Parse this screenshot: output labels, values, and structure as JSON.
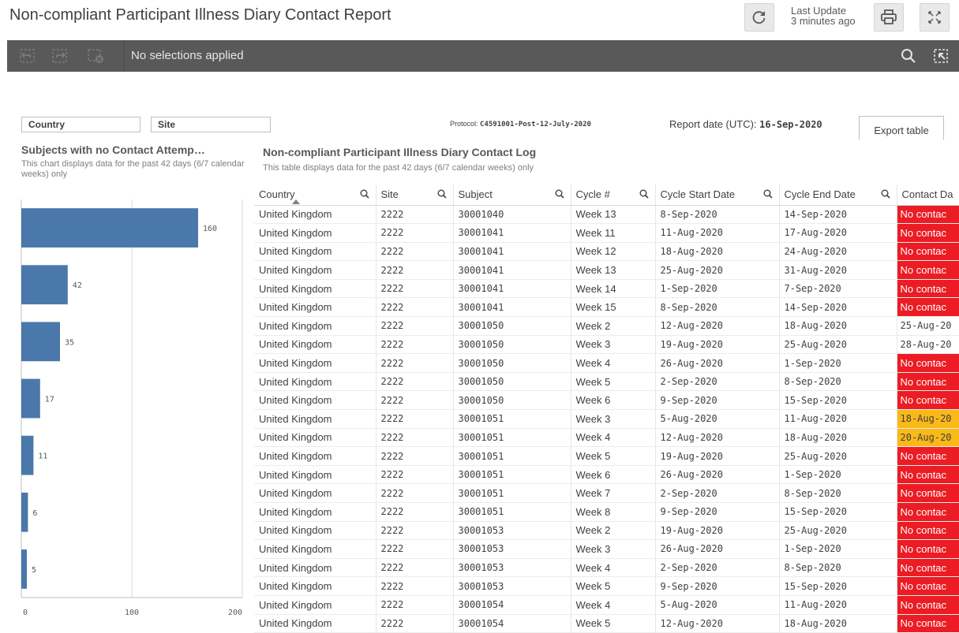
{
  "app": {
    "title": "Non-compliant Participant Illness Diary Contact Report",
    "last_update_line1": "Last Update",
    "last_update_line2": "3 minutes ago"
  },
  "selection_bar": {
    "status": "No selections applied"
  },
  "filters": {
    "country_label": "Country",
    "site_label": "Site"
  },
  "header": {
    "protocol_label": "Protocol:",
    "protocol_value": "C4591001-Post-12-July-2020",
    "report_date_label": "Report date (UTC):",
    "report_date_value": "16-Sep-2020",
    "export_label": "Export table"
  },
  "chart_panel": {
    "title": "Subjects with no Contact Attemp…",
    "subtitle": "This chart displays data for the past 42 days (6/7 calendar weeks) only"
  },
  "chart_data": {
    "type": "bar",
    "orientation": "horizontal",
    "values": [
      160,
      42,
      35,
      17,
      11,
      6,
      5
    ],
    "xlim": [
      0,
      200
    ],
    "xticks": [
      0,
      100,
      200
    ],
    "bar_color": "#4a78ab",
    "grid": true
  },
  "table_panel": {
    "title": "Non-compliant Participant Illness Diary Contact Log",
    "subtitle": "This table displays data for the past 42 days (6/7 calendar weeks) only"
  },
  "table": {
    "columns": [
      "Country",
      "Site",
      "Subject",
      "Cycle #",
      "Cycle Start Date",
      "Cycle End Date",
      "Contact Da"
    ],
    "status_colors": {
      "red": "#ec1c24",
      "amber": "#f8b919"
    },
    "rows": [
      [
        "United Kingdom",
        "2222",
        "30001040",
        "Week 13",
        "8-Sep-2020",
        "14-Sep-2020",
        "No contac",
        "red"
      ],
      [
        "United Kingdom",
        "2222",
        "30001041",
        "Week 11",
        "11-Aug-2020",
        "17-Aug-2020",
        "No contac",
        "red"
      ],
      [
        "United Kingdom",
        "2222",
        "30001041",
        "Week 12",
        "18-Aug-2020",
        "24-Aug-2020",
        "No contac",
        "red"
      ],
      [
        "United Kingdom",
        "2222",
        "30001041",
        "Week 13",
        "25-Aug-2020",
        "31-Aug-2020",
        "No contac",
        "red"
      ],
      [
        "United Kingdom",
        "2222",
        "30001041",
        "Week 14",
        "1-Sep-2020",
        "7-Sep-2020",
        "No contac",
        "red"
      ],
      [
        "United Kingdom",
        "2222",
        "30001041",
        "Week 15",
        "8-Sep-2020",
        "14-Sep-2020",
        "No contac",
        "red"
      ],
      [
        "United Kingdom",
        "2222",
        "30001050",
        "Week 2",
        "12-Aug-2020",
        "18-Aug-2020",
        "25-Aug-20",
        "none"
      ],
      [
        "United Kingdom",
        "2222",
        "30001050",
        "Week 3",
        "19-Aug-2020",
        "25-Aug-2020",
        "28-Aug-20",
        "none"
      ],
      [
        "United Kingdom",
        "2222",
        "30001050",
        "Week 4",
        "26-Aug-2020",
        "1-Sep-2020",
        "No contac",
        "red"
      ],
      [
        "United Kingdom",
        "2222",
        "30001050",
        "Week 5",
        "2-Sep-2020",
        "8-Sep-2020",
        "No contac",
        "red"
      ],
      [
        "United Kingdom",
        "2222",
        "30001050",
        "Week 6",
        "9-Sep-2020",
        "15-Sep-2020",
        "No contac",
        "red"
      ],
      [
        "United Kingdom",
        "2222",
        "30001051",
        "Week 3",
        "5-Aug-2020",
        "11-Aug-2020",
        "18-Aug-20",
        "amber"
      ],
      [
        "United Kingdom",
        "2222",
        "30001051",
        "Week 4",
        "12-Aug-2020",
        "18-Aug-2020",
        "20-Aug-20",
        "amber"
      ],
      [
        "United Kingdom",
        "2222",
        "30001051",
        "Week 5",
        "19-Aug-2020",
        "25-Aug-2020",
        "No contac",
        "red"
      ],
      [
        "United Kingdom",
        "2222",
        "30001051",
        "Week 6",
        "26-Aug-2020",
        "1-Sep-2020",
        "No contac",
        "red"
      ],
      [
        "United Kingdom",
        "2222",
        "30001051",
        "Week 7",
        "2-Sep-2020",
        "8-Sep-2020",
        "No contac",
        "red"
      ],
      [
        "United Kingdom",
        "2222",
        "30001051",
        "Week 8",
        "9-Sep-2020",
        "15-Sep-2020",
        "No contac",
        "red"
      ],
      [
        "United Kingdom",
        "2222",
        "30001053",
        "Week 2",
        "19-Aug-2020",
        "25-Aug-2020",
        "No contac",
        "red"
      ],
      [
        "United Kingdom",
        "2222",
        "30001053",
        "Week 3",
        "26-Aug-2020",
        "1-Sep-2020",
        "No contac",
        "red"
      ],
      [
        "United Kingdom",
        "2222",
        "30001053",
        "Week 4",
        "2-Sep-2020",
        "8-Sep-2020",
        "No contac",
        "red"
      ],
      [
        "United Kingdom",
        "2222",
        "30001053",
        "Week 5",
        "9-Sep-2020",
        "15-Sep-2020",
        "No contac",
        "red"
      ],
      [
        "United Kingdom",
        "2222",
        "30001054",
        "Week 4",
        "5-Aug-2020",
        "11-Aug-2020",
        "No contac",
        "red"
      ],
      [
        "United Kingdom",
        "2222",
        "30001054",
        "Week 5",
        "12-Aug-2020",
        "18-Aug-2020",
        "No contac",
        "red"
      ]
    ]
  },
  "icons": {
    "reload": "reload-icon",
    "print": "print-icon",
    "fullscreen": "fullscreen-icon",
    "step_back": "step-back-icon",
    "step_forward": "step-forward-icon",
    "clear_all": "clear-all-icon",
    "search": "search-icon",
    "smart_search": "smart-search-icon",
    "column_search": "column-search-icon"
  }
}
